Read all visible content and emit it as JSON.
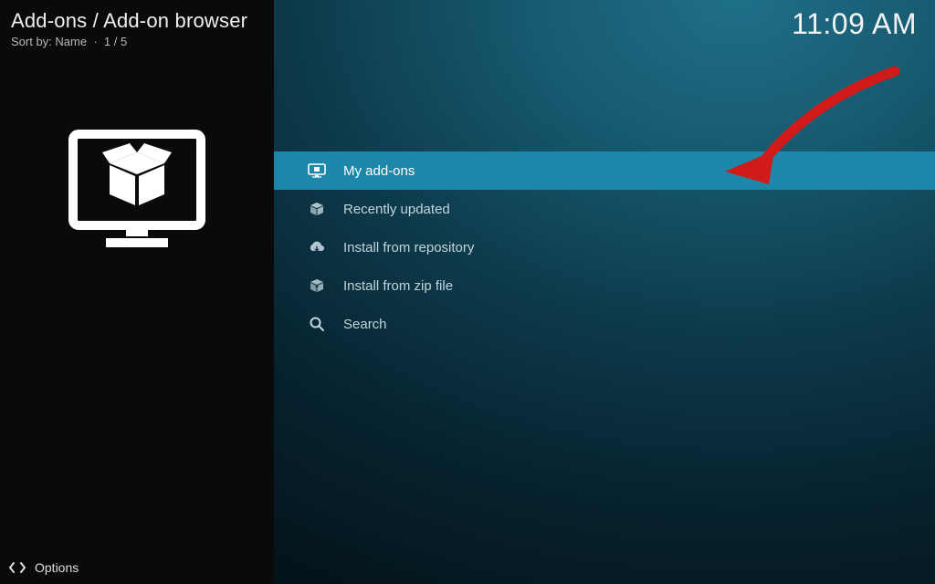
{
  "header": {
    "breadcrumb": "Add-ons / Add-on browser",
    "sort_prefix": "Sort by:",
    "sort_value": "Name",
    "sort_separator": "·",
    "position": "1 / 5"
  },
  "clock": "11:09 AM",
  "side_image": {
    "name": "addons-box-monitor-icon"
  },
  "menu": {
    "selected_index": 0,
    "items": [
      {
        "label": "My add-ons",
        "icon": "monitor-addon-icon"
      },
      {
        "label": "Recently updated",
        "icon": "open-box-icon"
      },
      {
        "label": "Install from repository",
        "icon": "cloud-download-icon"
      },
      {
        "label": "Install from zip file",
        "icon": "zip-file-icon"
      },
      {
        "label": "Search",
        "icon": "search-icon"
      }
    ]
  },
  "footer": {
    "options_label": "Options",
    "icon": "options-arrows-icon"
  },
  "annotation": {
    "arrow_color": "#d11b1b",
    "target": "My add-ons"
  }
}
